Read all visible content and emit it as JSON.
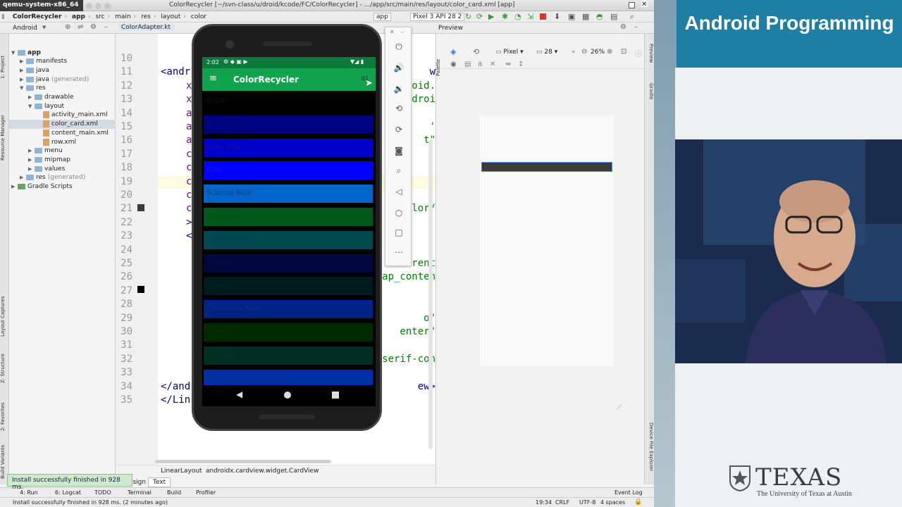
{
  "emulator_window_title": "qemu-system-x86_64",
  "window_title": "ColorRecycler [~/svn-class/u/droid/kcode/FC/ColorRecycler] - .../app/src/main/res/layout/color_card.xml [app]",
  "breadcrumbs": [
    "ColorRecycler",
    "app",
    "src",
    "main",
    "res",
    "layout",
    "color"
  ],
  "toolbar": {
    "device_label": "Pixel 3 API 28 2",
    "app_config": "app"
  },
  "project_panel": {
    "view_mode": "Android",
    "tab": "ColorAdapter.kt",
    "tree": [
      {
        "label": "app",
        "depth": 0,
        "type": "folder",
        "expanded": true,
        "bold": true
      },
      {
        "label": "manifests",
        "depth": 1,
        "type": "folder"
      },
      {
        "label": "java",
        "depth": 1,
        "type": "folder"
      },
      {
        "label": "java",
        "suffix": "(generated)",
        "depth": 1,
        "type": "folder"
      },
      {
        "label": "res",
        "depth": 1,
        "type": "folder",
        "expanded": true
      },
      {
        "label": "drawable",
        "depth": 2,
        "type": "folder"
      },
      {
        "label": "layout",
        "depth": 2,
        "type": "folder",
        "expanded": true
      },
      {
        "label": "activity_main.xml",
        "depth": 3,
        "type": "xml"
      },
      {
        "label": "color_card.xml",
        "depth": 3,
        "type": "xml",
        "selected": true
      },
      {
        "label": "content_main.xml",
        "depth": 3,
        "type": "xml"
      },
      {
        "label": "row.xml",
        "depth": 3,
        "type": "xml"
      },
      {
        "label": "menu",
        "depth": 2,
        "type": "folder"
      },
      {
        "label": "mipmap",
        "depth": 2,
        "type": "folder"
      },
      {
        "label": "values",
        "depth": 2,
        "type": "folder"
      },
      {
        "label": "res",
        "suffix": "(generated)",
        "depth": 1,
        "type": "folder"
      },
      {
        "label": "Gradle Scripts",
        "depth": 0,
        "type": "gradle"
      }
    ]
  },
  "left_tool_strip": [
    "1: Project",
    "Resource Manager",
    "Layout Captures",
    "Z: Structure",
    "2: Favorites",
    "Build Variants"
  ],
  "editor": {
    "line_numbers": [
      "10",
      "11",
      "12",
      "13",
      "14",
      "15",
      "16",
      "17",
      "18",
      "19",
      "20",
      "21",
      "22",
      "23",
      "24",
      "25",
      "26",
      "27",
      "28",
      "29",
      "30",
      "31",
      "32",
      "33",
      "34",
      "35"
    ],
    "current_line": "19",
    "left_code": [
      {
        "line": "11",
        "text": "<andr",
        "color": "#000080"
      },
      {
        "line": "12",
        "text": "x",
        "color": "#660e7a"
      },
      {
        "line": "13",
        "text": "x",
        "color": "#660e7a"
      },
      {
        "line": "14",
        "text": "a",
        "color": "#660e7a"
      },
      {
        "line": "15",
        "text": "a",
        "color": "#660e7a"
      },
      {
        "line": "16",
        "text": "a",
        "color": "#660e7a"
      },
      {
        "line": "17",
        "text": "c",
        "color": "#660e7a"
      },
      {
        "line": "18",
        "text": "c",
        "color": "#660e7a"
      },
      {
        "line": "19",
        "text": "c",
        "color": "#660e7a"
      },
      {
        "line": "20",
        "text": "c",
        "color": "#660e7a"
      },
      {
        "line": "21",
        "text": "c",
        "color": "#660e7a"
      },
      {
        "line": "22",
        "text": ">",
        "color": "#000080"
      },
      {
        "line": "23",
        "text": "<",
        "color": "#000080"
      },
      {
        "line": "34",
        "text": "</and",
        "color": "#000080"
      },
      {
        "line": "35",
        "text": "</Lin",
        "color": "#000080"
      }
    ],
    "right_code": [
      {
        "line": "11",
        "text": "w",
        "color": "#000080"
      },
      {
        "line": "12",
        "text": "oid.",
        "color": "#008000"
      },
      {
        "line": "13",
        "text": "droi",
        "color": "#008000"
      },
      {
        "line": "15",
        "text": "'",
        "color": "#008000"
      },
      {
        "line": "16",
        "text": "t\"",
        "color": "#008000"
      },
      {
        "line": "21",
        "text": "lor/",
        "color": "#008000"
      },
      {
        "line": "25",
        "text": "rent",
        "color": "#008000"
      },
      {
        "line": "26",
        "text": "ap_conten",
        "color": "#008000"
      },
      {
        "line": "29",
        "text": "o\"",
        "color": "#008000"
      },
      {
        "line": "30",
        "text": "enter\"",
        "color": "#008000"
      },
      {
        "line": "32",
        "text": "serif-con",
        "color": "#008000"
      },
      {
        "line": "34",
        "text": "ew>",
        "color": "#000080"
      }
    ],
    "footer_breadcrumb": [
      "LinearLayout",
      "androidx.cardview.widget.CardView"
    ],
    "mode_tabs": [
      "Design",
      "Text"
    ],
    "active_mode_tab": "Text"
  },
  "preview_panel": {
    "title": "Preview",
    "device": "Pixel",
    "api": "28",
    "zoom": "26%",
    "side_labels": [
      "Palette",
      "Preview",
      "Gradle",
      "Device File Explorer"
    ]
  },
  "phone": {
    "time": "2:02",
    "app_title": "ColorRecycler",
    "colors": [
      {
        "name": "Black",
        "hex": "#000000",
        "text_color": "#111111"
      },
      {
        "name": "Navy Blue",
        "hex": "#000080",
        "text_color": "#0a0a6a"
      },
      {
        "name": "Dark Blue",
        "hex": "#0000c8",
        "text_color": "#1010aa"
      },
      {
        "name": "Blue",
        "hex": "#0000ff",
        "text_color": "#1818d8"
      },
      {
        "name": "Science Blue",
        "hex": "#0066cc",
        "text_color": "#0d3f72"
      },
      {
        "name": "Camarone",
        "hex": "#00581a",
        "text_color": "#0c4a17"
      },
      {
        "name": "Sherpa Blue",
        "hex": "#004950",
        "text_color": "#0b4046"
      },
      {
        "name": "Stratos",
        "hex": "#000741",
        "text_color": "#0a0f3a"
      },
      {
        "name": "Swamp",
        "hex": "#001b1c",
        "text_color": "#0b2324"
      },
      {
        "name": "Resolution Blue",
        "hex": "#002387",
        "text_color": "#0f2c78"
      },
      {
        "name": "Deep Fir",
        "hex": "#002900",
        "text_color": "#0c2f0c"
      },
      {
        "name": "Burnham",
        "hex": "#002e20",
        "text_color": "#0c3325"
      },
      {
        "name": "International Klein Blue",
        "hex": "#002fa7",
        "text_color": "#12348f"
      }
    ]
  },
  "emulator_controls": [
    "power-icon",
    "volume-up-icon",
    "volume-down-icon",
    "rotate-left-icon",
    "rotate-right-icon",
    "camera-icon",
    "zoom-icon",
    "back-icon",
    "home-icon",
    "overview-icon",
    "more-icon"
  ],
  "bottom_tool_tabs": [
    "4: Run",
    "6: Logcat",
    "TODO",
    "Terminal",
    "Build",
    "Profiler",
    "Event Log"
  ],
  "toast": "Install successfully finished in 928 ms.",
  "status": {
    "message": "Install successfully finished in 928 ms. (2 minutes ago)",
    "position": "19:34",
    "line_sep": "CRLF",
    "encoding": "UTF-8",
    "indent": "4 spaces"
  },
  "branding": {
    "course_title": "Android Programming",
    "university_wordmark": "TEXAS",
    "university_full": "The University of Texas at Austin",
    "bg_color": "#1f7ea3"
  }
}
